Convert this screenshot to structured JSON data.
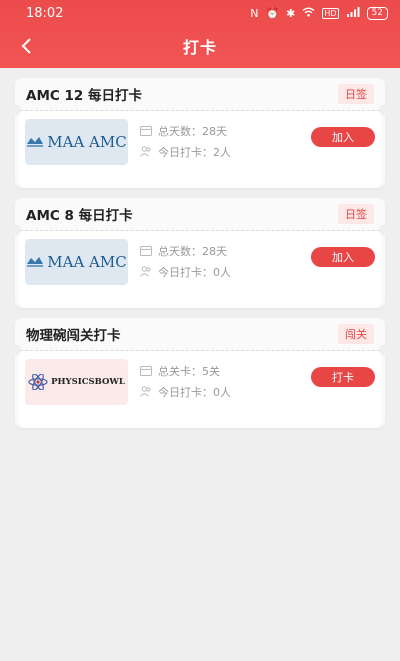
{
  "status_bar": {
    "time": "18:02",
    "battery": "52"
  },
  "nav": {
    "title": "打卡"
  },
  "cards": [
    {
      "title": "AMC 12 每日打卡",
      "tag": "日签",
      "logo": "MAA AMC",
      "line1_label": "总天数：",
      "line1_value": "28天",
      "line2_label": "今日打卡：",
      "line2_value": "2人",
      "button": "加入"
    },
    {
      "title": "AMC 8 每日打卡",
      "tag": "日签",
      "logo": "MAA AMC",
      "line1_label": "总天数：",
      "line1_value": "28天",
      "line2_label": "今日打卡：",
      "line2_value": "0人",
      "button": "加入"
    },
    {
      "title": "物理碗闯关打卡",
      "tag": "闯关",
      "logo": "PHYSICSBOWL",
      "line1_label": "总关卡：",
      "line1_value": "5关",
      "line2_label": "今日打卡：",
      "line2_value": "0人",
      "button": "打卡"
    }
  ],
  "colors": {
    "accent": "#e84545",
    "header": "#ef4f4f",
    "background": "#efefef"
  }
}
